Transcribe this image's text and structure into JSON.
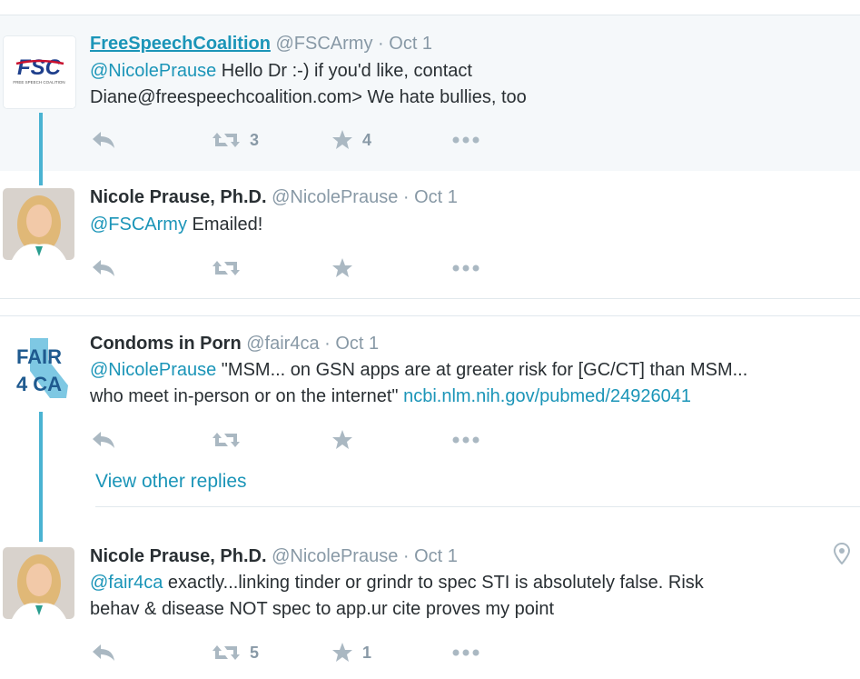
{
  "tweets": [
    {
      "name": "FreeSpeechCoalition",
      "handle": "@FSCArmy",
      "dot": "·",
      "time": "Oct 1",
      "mention": "@NicolePrause",
      "text_line1": " Hello Dr :-) if you'd like, contact",
      "text_line2": "Diane@freespeechcoalition.com> We hate bullies, too",
      "retweets": "3",
      "favorites": "4",
      "avatar_text": "FSC",
      "avatar_subtext": "FREE SPEECH COALITION"
    },
    {
      "name": "Nicole Prause, Ph.D.",
      "handle": "@NicolePrause",
      "dot": "·",
      "time": "Oct 1",
      "mention": "@FSCArmy",
      "text": " Emailed!"
    },
    {
      "name": "Condoms in Porn",
      "handle": "@fair4ca",
      "dot": "·",
      "time": "Oct 1",
      "mention": "@NicolePrause",
      "text_line1": " \"MSM... on GSN apps are at greater risk for [GC/CT] than MSM...",
      "text_line2": "who meet in-person or on the internet\" ",
      "url": "ncbi.nlm.nih.gov/pubmed/24926041",
      "avatar_line1": "FAIR",
      "avatar_line2": "4 CA"
    },
    {
      "name": "Nicole Prause, Ph.D.",
      "handle": "@NicolePrause",
      "dot": "·",
      "time": "Oct 1",
      "mention": "@fair4ca",
      "text_line1": " exactly...linking tinder or grindr to spec STI is absolutely false. Risk",
      "text_line2": "behav & disease NOT spec to app.ur cite proves my point",
      "retweets": "5",
      "favorites": "1"
    }
  ],
  "view_other_replies": "View other replies",
  "icons": {
    "reply": "reply-icon",
    "retweet": "retweet-icon",
    "favorite": "star-icon",
    "more": "more-icon",
    "location": "location-pin-icon"
  },
  "colors": {
    "link": "#1b95b8",
    "thread_line": "#4ab3d2",
    "muted": "#8899a6",
    "icon": "#aab8c2",
    "highlight_bg": "#f5f8fa"
  }
}
